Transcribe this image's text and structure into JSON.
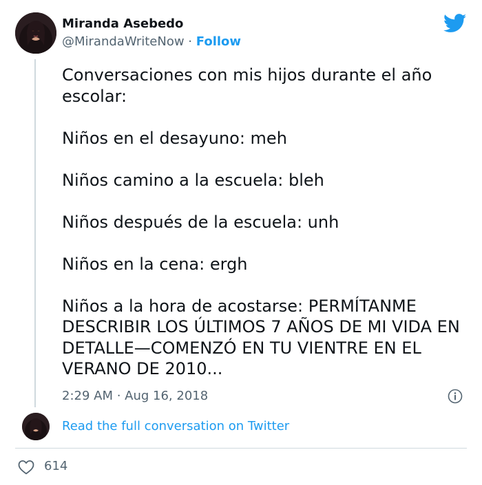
{
  "author": {
    "name": "Miranda Asebedo",
    "handle": "@MirandaWriteNow",
    "separator": "·",
    "follow_label": "Follow"
  },
  "tweet": {
    "lines": [
      "Conversaciones con mis hijos durante el año escolar:",
      "Niños en el desayuno: meh",
      "Niños camino a la escuela: bleh",
      "Niños después de la escuela: unh",
      "Niños en la cena: ergh",
      "Niños a la hora de acostarse: PERMÍTANME DESCRIBIR LOS ÚLTIMOS 7 AÑOS DE MI VIDA EN DETALLE—COMENZÓ EN TU VIENTRE EN EL VERANO DE 2010..."
    ],
    "timestamp": "2:29 AM · Aug 16, 2018"
  },
  "conversation_link": "Read the full conversation on Twitter",
  "likes": "614",
  "icons": {
    "brand": "twitter-bird-icon",
    "info": "info-icon",
    "like": "heart-icon"
  },
  "colors": {
    "accent": "#1d9bf0",
    "text": "#0f1419",
    "muted": "#536471",
    "divider": "#cfd9de"
  }
}
